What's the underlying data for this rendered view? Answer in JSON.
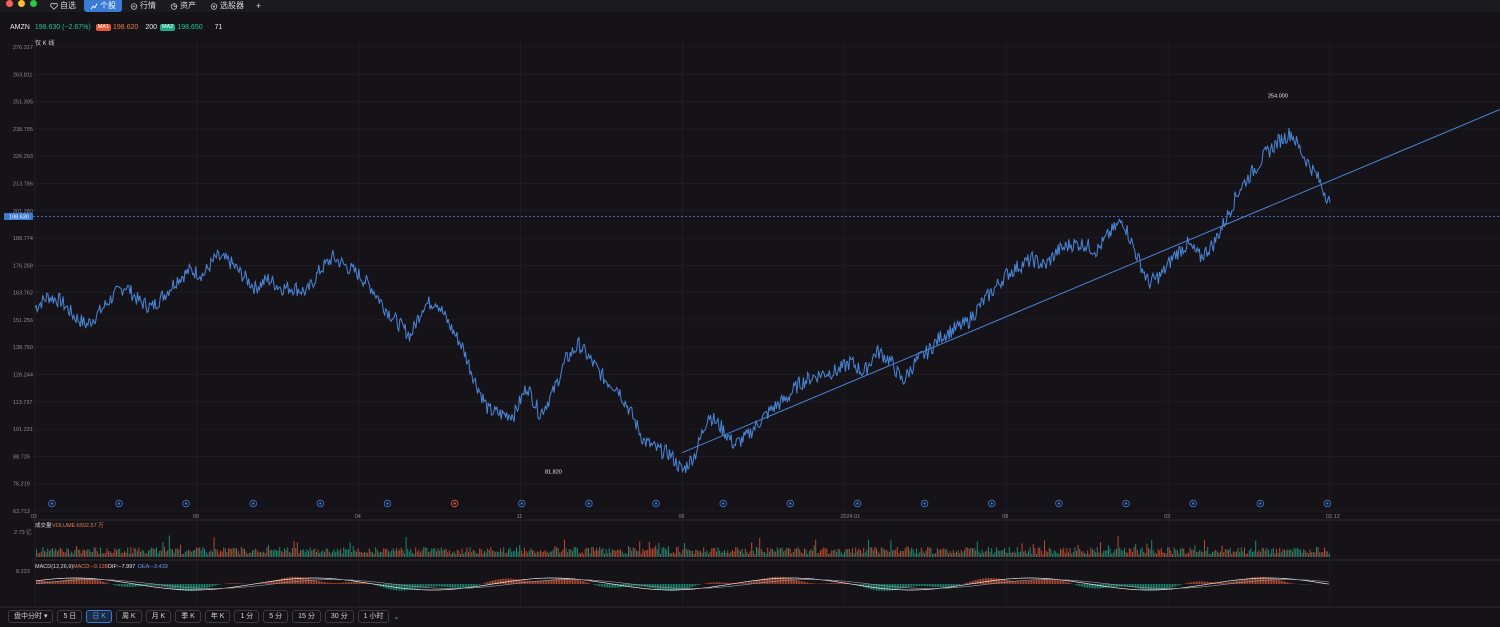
{
  "window": {
    "traffic_lights": [
      "#ff5f57",
      "#febc2e",
      "#28c840"
    ]
  },
  "tabs": [
    {
      "label": "自选",
      "icon": "heart-icon",
      "active": false
    },
    {
      "label": "个股",
      "icon": "chart-icon",
      "active": true
    },
    {
      "label": "行情",
      "icon": "market-icon",
      "active": false
    },
    {
      "label": "资产",
      "icon": "pie-icon",
      "active": false
    },
    {
      "label": "选股器",
      "icon": "filter-icon",
      "active": false
    }
  ],
  "add_tab_label": "+",
  "quote": {
    "symbol": "AMZN",
    "price": "198.630 (−2.67%)",
    "ma1_badge": "MA1",
    "ma1_value": "198.620",
    "ma2_label": "200",
    "ma2_badge": "MA2",
    "ma2_value": "198.650",
    "extra": "71"
  },
  "colors": {
    "accent": "#3a7bd5",
    "up": "#e05a3a",
    "down": "#1fa88a",
    "line": "#4a86d8"
  },
  "chart_label": "仅 K 线",
  "chart_data": {
    "type": "line",
    "y_ticks": [
      "276.317",
      "263.811",
      "251.305",
      "238.795",
      "226.293",
      "213.786",
      "201.280",
      "188.774",
      "176.268",
      "163.762",
      "151.256",
      "138.750",
      "126.244",
      "113.737",
      "101.231",
      "88.725",
      "76.219",
      "63.713"
    ],
    "x_ticks": [
      "02",
      "09",
      "04",
      "11",
      "06",
      "2024.01",
      "08",
      "03",
      "02.12"
    ],
    "ylim": [
      63.713,
      276.317
    ],
    "current_price_tag": "198.630",
    "high_label": "254.000",
    "low_label": "81.820",
    "trendline": {
      "x": [
        0.5,
        1.0
      ],
      "y": [
        90.5,
        215
      ]
    },
    "markers": [
      {
        "type": "blue"
      },
      {
        "type": "blue"
      },
      {
        "type": "blue"
      },
      {
        "type": "blue"
      },
      {
        "type": "blue"
      },
      {
        "type": "blue"
      },
      {
        "type": "red"
      },
      {
        "type": "blue"
      },
      {
        "type": "blue"
      },
      {
        "type": "blue"
      },
      {
        "type": "blue"
      },
      {
        "type": "blue"
      },
      {
        "type": "blue"
      },
      {
        "type": "blue"
      },
      {
        "type": "blue"
      },
      {
        "type": "blue"
      },
      {
        "type": "blue"
      },
      {
        "type": "blue"
      },
      {
        "type": "blue"
      },
      {
        "type": "blue"
      }
    ],
    "price_points": [
      [
        0.0,
        157
      ],
      [
        0.01,
        162
      ],
      [
        0.02,
        160
      ],
      [
        0.03,
        153
      ],
      [
        0.04,
        149
      ],
      [
        0.05,
        155
      ],
      [
        0.06,
        162
      ],
      [
        0.07,
        167
      ],
      [
        0.08,
        160
      ],
      [
        0.09,
        157
      ],
      [
        0.1,
        163
      ],
      [
        0.11,
        170
      ],
      [
        0.12,
        174
      ],
      [
        0.13,
        172
      ],
      [
        0.14,
        180
      ],
      [
        0.15,
        178
      ],
      [
        0.16,
        172
      ],
      [
        0.17,
        166
      ],
      [
        0.18,
        170
      ],
      [
        0.19,
        166
      ],
      [
        0.2,
        166
      ],
      [
        0.21,
        164
      ],
      [
        0.22,
        174
      ],
      [
        0.23,
        180
      ],
      [
        0.24,
        176
      ],
      [
        0.25,
        172
      ],
      [
        0.26,
        166
      ],
      [
        0.27,
        157
      ],
      [
        0.28,
        150
      ],
      [
        0.29,
        144
      ],
      [
        0.3,
        158
      ],
      [
        0.31,
        160
      ],
      [
        0.32,
        149
      ],
      [
        0.33,
        139
      ],
      [
        0.34,
        123
      ],
      [
        0.35,
        110
      ],
      [
        0.36,
        108
      ],
      [
        0.37,
        108
      ],
      [
        0.38,
        121
      ],
      [
        0.39,
        108
      ],
      [
        0.4,
        118
      ],
      [
        0.41,
        133
      ],
      [
        0.42,
        140
      ],
      [
        0.43,
        132
      ],
      [
        0.44,
        124
      ],
      [
        0.45,
        120
      ],
      [
        0.46,
        109
      ],
      [
        0.47,
        96
      ],
      [
        0.48,
        92
      ],
      [
        0.49,
        90
      ],
      [
        0.5,
        82
      ],
      [
        0.51,
        90
      ],
      [
        0.52,
        108
      ],
      [
        0.53,
        102
      ],
      [
        0.54,
        94
      ],
      [
        0.55,
        98
      ],
      [
        0.56,
        105
      ],
      [
        0.57,
        111
      ],
      [
        0.58,
        115
      ],
      [
        0.59,
        122
      ],
      [
        0.6,
        125
      ],
      [
        0.61,
        127
      ],
      [
        0.62,
        128
      ],
      [
        0.63,
        132
      ],
      [
        0.64,
        127
      ],
      [
        0.65,
        137
      ],
      [
        0.66,
        133
      ],
      [
        0.67,
        123
      ],
      [
        0.68,
        132
      ],
      [
        0.69,
        137
      ],
      [
        0.7,
        144
      ],
      [
        0.71,
        147
      ],
      [
        0.72,
        150
      ],
      [
        0.73,
        158
      ],
      [
        0.74,
        165
      ],
      [
        0.75,
        172
      ],
      [
        0.76,
        176
      ],
      [
        0.77,
        179
      ],
      [
        0.78,
        176
      ],
      [
        0.79,
        183
      ],
      [
        0.8,
        186
      ],
      [
        0.81,
        186
      ],
      [
        0.82,
        183
      ],
      [
        0.83,
        191
      ],
      [
        0.84,
        197
      ],
      [
        0.85,
        182
      ],
      [
        0.86,
        168
      ],
      [
        0.87,
        172
      ],
      [
        0.88,
        181
      ],
      [
        0.89,
        186
      ],
      [
        0.9,
        180
      ],
      [
        0.91,
        186
      ],
      [
        0.92,
        198
      ],
      [
        0.93,
        211
      ],
      [
        0.94,
        219
      ],
      [
        0.95,
        227
      ],
      [
        0.96,
        233
      ],
      [
        0.97,
        237
      ],
      [
        0.98,
        226
      ],
      [
        0.99,
        217
      ],
      [
        1.0,
        205
      ]
    ]
  },
  "volume": {
    "label": "成交量",
    "value_label": "VOLUME:6502.57 万",
    "y_tick": "2.73 亿"
  },
  "macd": {
    "label": "MACD(12,26,9)",
    "macd_value": "MACD:−9.128",
    "dif_value": "DIF:−7.997",
    "dea_value": "DEA:−3.433",
    "y_tick": "8.233"
  },
  "periods": [
    {
      "label": "盘中分时",
      "active": false,
      "dropdown": true
    },
    {
      "label": "5 日",
      "active": false
    },
    {
      "label": "日 K",
      "active": true
    },
    {
      "label": "周 K",
      "active": false
    },
    {
      "label": "月 K",
      "active": false
    },
    {
      "label": "季 K",
      "active": false
    },
    {
      "label": "年 K",
      "active": false
    },
    {
      "label": "1 分",
      "active": false
    },
    {
      "label": "5 分",
      "active": false
    },
    {
      "label": "15 分",
      "active": false
    },
    {
      "label": "30 分",
      "active": false
    },
    {
      "label": "1 小时",
      "active": false
    }
  ],
  "more_icon": "chevron-down-icon",
  "more_glyph": "⌄"
}
